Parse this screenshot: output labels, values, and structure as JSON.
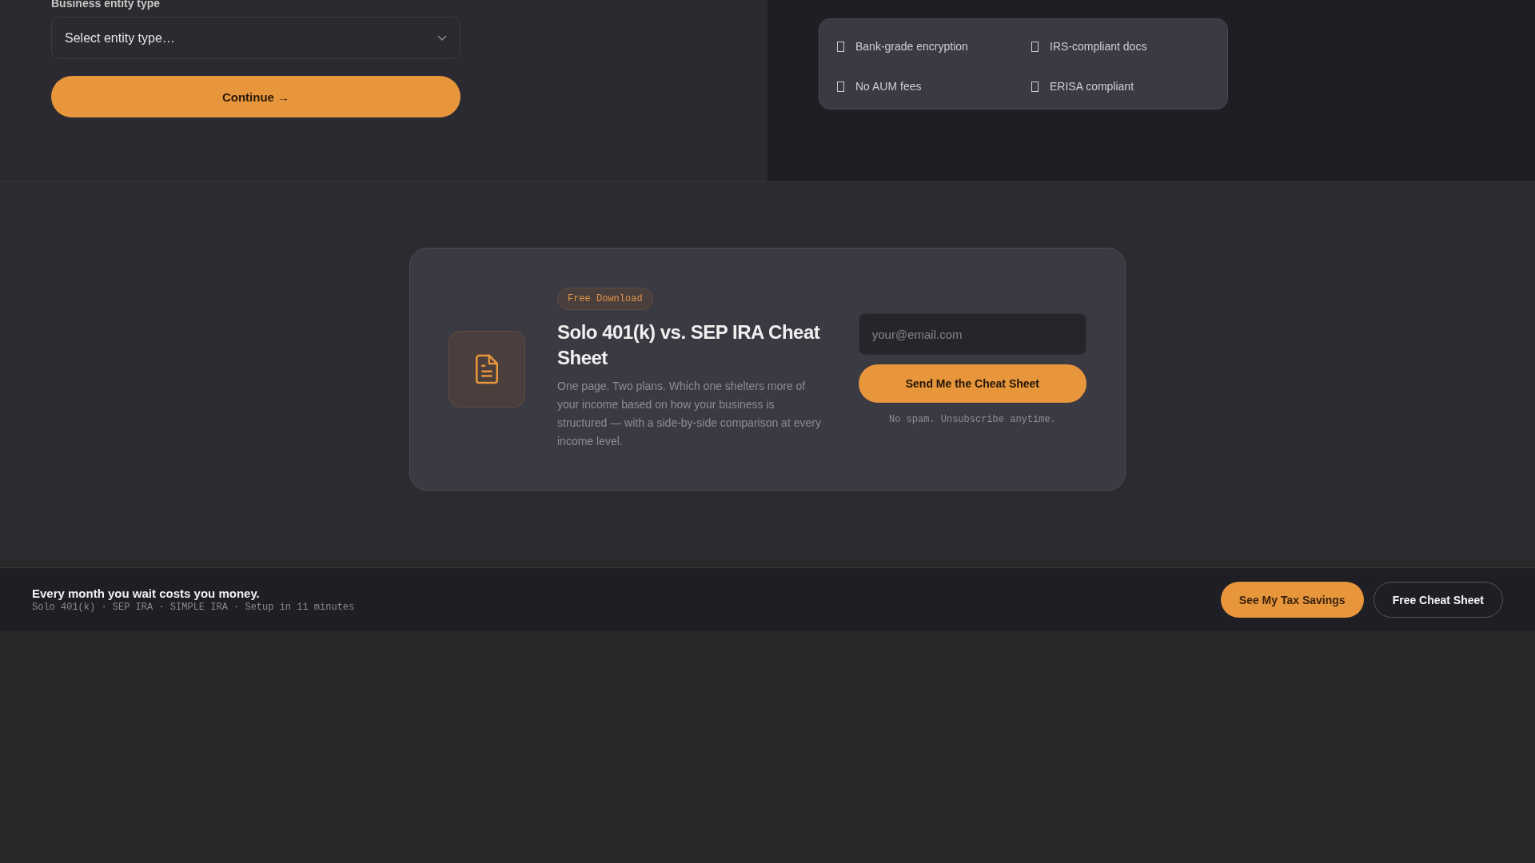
{
  "entity_form": {
    "label": "Business entity type",
    "select": {
      "placeholder": "Select entity type…"
    },
    "continue_button": "Continue →"
  },
  "trust_badges": [
    "Bank-grade encryption",
    "IRS-compliant docs",
    "No AUM fees",
    "ERISA compliant"
  ],
  "lead_magnet": {
    "badge": "Free Download",
    "title": "Solo 401(k) vs. SEP IRA Cheat Sheet",
    "description": "One page. Two plans. Which one shelters more of your income based on how your business is structured — with a side-by-side comparison at every income level.",
    "email": {
      "placeholder": "your@email.com"
    },
    "submit_button": "Send Me the Cheat Sheet",
    "note": "No spam. Unsubscribe anytime."
  },
  "sticky_bar": {
    "headline": "Every month you wait costs you money.",
    "subline": "Solo 401(k) · SEP IRA · SIMPLE IRA · Setup in 11 minutes",
    "buttons": [
      {
        "label": "See My Tax Savings",
        "kind": "primary"
      },
      {
        "label": "Free Cheat Sheet",
        "kind": "outline"
      }
    ]
  }
}
